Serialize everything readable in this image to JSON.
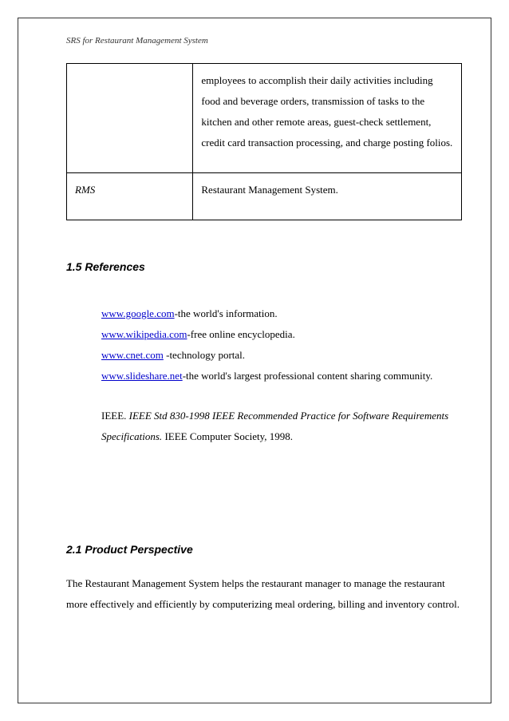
{
  "header": "SRS for Restaurant Management System",
  "table": {
    "row1_def": "employees to accomplish their daily activities including food and beverage orders, transmission of tasks to the kitchen and other remote areas, guest-check settlement, credit card transaction processing, and charge posting folios.",
    "row2_term": "RMS",
    "row2_def": "Restaurant Management System."
  },
  "sections": {
    "references_heading": "1.5 References",
    "perspective_heading": "2.1 Product Perspective"
  },
  "refs": {
    "r1_link": "www.google.com",
    "r1_tail": "-the world's information.",
    "r2_link": "www.wikipedia.com",
    "r2_tail": "-free online encyclopedia.",
    "r3_link": "www.cnet.com",
    "r3_tail": " -technology portal.",
    "r4_link": "www.slideshare.net",
    "r4_tail": "-the world's largest professional content sharing community."
  },
  "ieee": {
    "pre": "IEEE. ",
    "title": "IEEE Std 830-1998 IEEE Recommended Practice for Software Requirements Specifications.",
    "post": " IEEE Computer Society, 1998."
  },
  "perspective_body": "The Restaurant Management System helps the restaurant manager to manage the restaurant more effectively and efficiently by computerizing meal ordering, billing and inventory control."
}
